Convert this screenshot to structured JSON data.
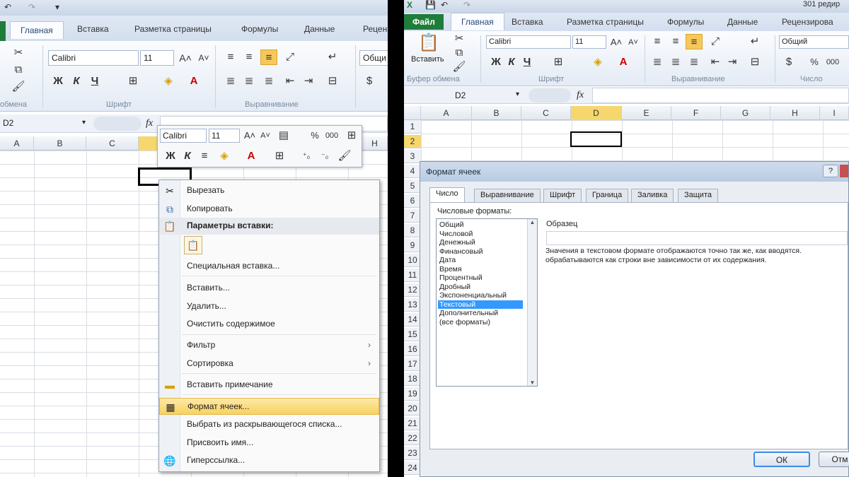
{
  "left": {
    "ribbon_tabs": [
      "Главная",
      "Вставка",
      "Разметка страницы",
      "Формулы",
      "Данные",
      "Реценз"
    ],
    "font_name": "Calibri",
    "font_size": "11",
    "bold_label": "Ж",
    "italic_label": "К",
    "underline_label": "Ч",
    "number_format": "Общи",
    "group_clipboard": "обмена",
    "group_font": "Шрифт",
    "group_align": "Выравнивание",
    "name_box": "D2",
    "fx_label": "fx",
    "columns": [
      "A",
      "B",
      "C",
      "H"
    ],
    "mini_toolbar": {
      "font": "Calibri",
      "size": "11",
      "percent": "%",
      "thousands": "000"
    },
    "context_menu": [
      {
        "label": "Вырезать",
        "icon": "scissors-icon"
      },
      {
        "label": "Копировать",
        "icon": "copy-icon"
      },
      {
        "label": "Параметры вставки:",
        "icon": "paste-icon",
        "header": true
      },
      {
        "label": "Специальная вставка..."
      },
      {
        "label": "Вставить..."
      },
      {
        "label": "Удалить..."
      },
      {
        "label": "Очистить содержимое"
      },
      {
        "label": "Фильтр",
        "submenu": true
      },
      {
        "label": "Сортировка",
        "submenu": true
      },
      {
        "label": "Вставить примечание",
        "icon": "comment-icon"
      },
      {
        "label": "Формат ячеек...",
        "icon": "format-cells-icon",
        "highlighted": true
      },
      {
        "label": "Выбрать из раскрывающегося списка..."
      },
      {
        "label": "Присвоить имя..."
      },
      {
        "label": "Гиперссылка...",
        "icon": "hyperlink-icon"
      }
    ]
  },
  "right": {
    "window_title": "301 редир",
    "file_tab": "Файл",
    "ribbon_tabs": [
      "Главная",
      "Вставка",
      "Разметка страницы",
      "Формулы",
      "Данные",
      "Рецензирова"
    ],
    "paste_label": "Вставить",
    "font_name": "Calibri",
    "font_size": "11",
    "bold_label": "Ж",
    "italic_label": "К",
    "underline_label": "Ч",
    "number_format": "Общий",
    "percent": "%",
    "thousands": "000",
    "group_clipboard": "Буфер обмена",
    "group_font": "Шрифт",
    "group_align": "Выравнивание",
    "group_number": "Число",
    "name_box": "D2",
    "fx_label": "fx",
    "columns": [
      "A",
      "B",
      "C",
      "D",
      "E",
      "F",
      "G",
      "H",
      "I"
    ],
    "rows": [
      "1",
      "2",
      "3",
      "4",
      "5",
      "6",
      "7",
      "8",
      "9",
      "10",
      "11",
      "12",
      "13",
      "14",
      "15",
      "16",
      "17",
      "18",
      "19",
      "20",
      "21",
      "22",
      "23",
      "24"
    ],
    "dialog": {
      "title": "Формат ячеек",
      "tabs": [
        "Число",
        "Выравнивание",
        "Шрифт",
        "Граница",
        "Заливка",
        "Защита"
      ],
      "formats_label": "Числовые форматы:",
      "formats": [
        "Общий",
        "Числовой",
        "Денежный",
        "Финансовый",
        "Дата",
        "Время",
        "Процентный",
        "Дробный",
        "Экспоненциальный",
        "Текстовый",
        "Дополнительный",
        "(все форматы)"
      ],
      "selected_index": 9,
      "sample_label": "Образец",
      "description_line1": "Значения в текстовом формате отображаются точно так же, как вводятся.",
      "description_line2": "обрабатываются как строки вне зависимости от их содержания.",
      "ok_label": "ОК",
      "cancel_label": "Отм"
    }
  }
}
